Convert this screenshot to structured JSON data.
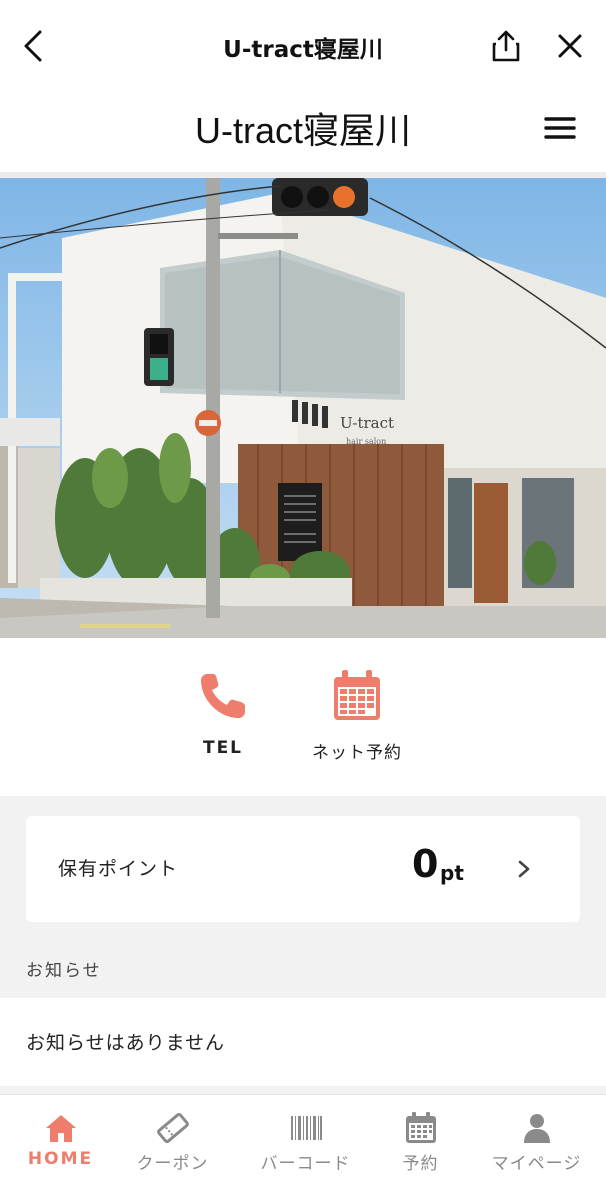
{
  "topbar": {
    "title": "U-tract寝屋川",
    "back_icon": "chevron-left-icon",
    "share_icon": "share-icon",
    "close_icon": "close-icon"
  },
  "site": {
    "name": "U-tract寝屋川",
    "menu_icon": "hamburger-icon"
  },
  "hero": {
    "sign_text": "U-tract",
    "sign_subtext": "hair salon",
    "image_semantic": "salon-building-photo"
  },
  "quick_actions": [
    {
      "label": "TEL",
      "icon": "phone-icon"
    },
    {
      "label": "ネット予約",
      "icon": "calendar-icon"
    }
  ],
  "points": {
    "label": "保有ポイント",
    "value": "0",
    "unit": "pt"
  },
  "news": {
    "title": "お知らせ",
    "empty_text": "お知らせはありません"
  },
  "bottom_nav": [
    {
      "label": "HOME",
      "icon": "home-icon",
      "active": true
    },
    {
      "label": "クーポン",
      "icon": "coupon-icon",
      "active": false
    },
    {
      "label": "バーコード",
      "icon": "barcode-icon",
      "active": false
    },
    {
      "label": "予約",
      "icon": "calendar-icon",
      "active": false
    },
    {
      "label": "マイページ",
      "icon": "user-icon",
      "active": false
    }
  ],
  "colors": {
    "accent": "#ee7d6b",
    "inactive": "#8a8a8a",
    "background": "#f2f2f2"
  }
}
